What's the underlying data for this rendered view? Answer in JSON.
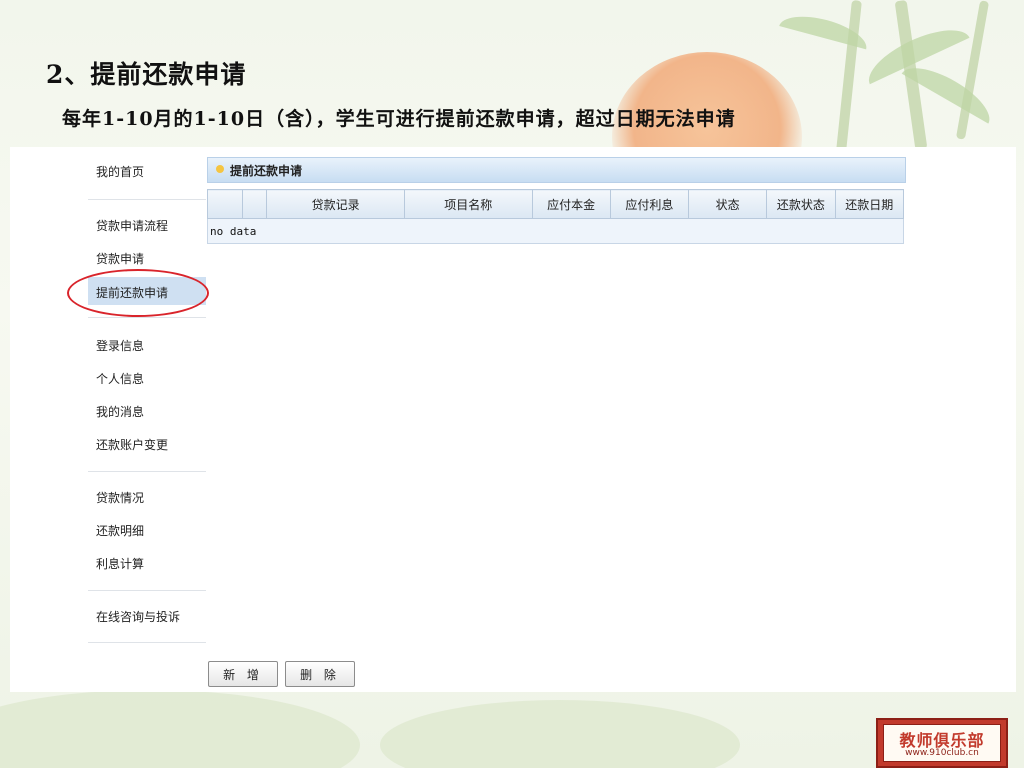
{
  "slide": {
    "title": "2、提前还款申请",
    "subtitle": "每年1-10月的1-10日（含），学生可进行提前还款申请，超过日期无法申请"
  },
  "sidebar": {
    "items": [
      {
        "label": "我的首页"
      },
      {
        "label": "贷款申请流程"
      },
      {
        "label": "贷款申请"
      },
      {
        "label": "提前还款申请",
        "active": true
      },
      {
        "label": "登录信息"
      },
      {
        "label": "个人信息"
      },
      {
        "label": "我的消息"
      },
      {
        "label": "还款账户变更"
      },
      {
        "label": "贷款情况"
      },
      {
        "label": "还款明细"
      },
      {
        "label": "利息计算"
      },
      {
        "label": "在线咨询与投诉"
      }
    ]
  },
  "panel": {
    "title": "提前还款申请"
  },
  "table": {
    "columns": [
      "",
      "",
      "贷款记录",
      "项目名称",
      "应付本金",
      "应付利息",
      "状态",
      "还款状态",
      "还款日期"
    ],
    "empty_text": "no data"
  },
  "buttons": {
    "add": "新 增",
    "delete": "删 除"
  },
  "logo": {
    "name": "教师俱乐部",
    "url": "www.910club.cn"
  },
  "colors": {
    "highlight_oval": "#d9242b",
    "active_item_bg": "#cfe0f2",
    "panel_header": "#c7ddf2"
  }
}
